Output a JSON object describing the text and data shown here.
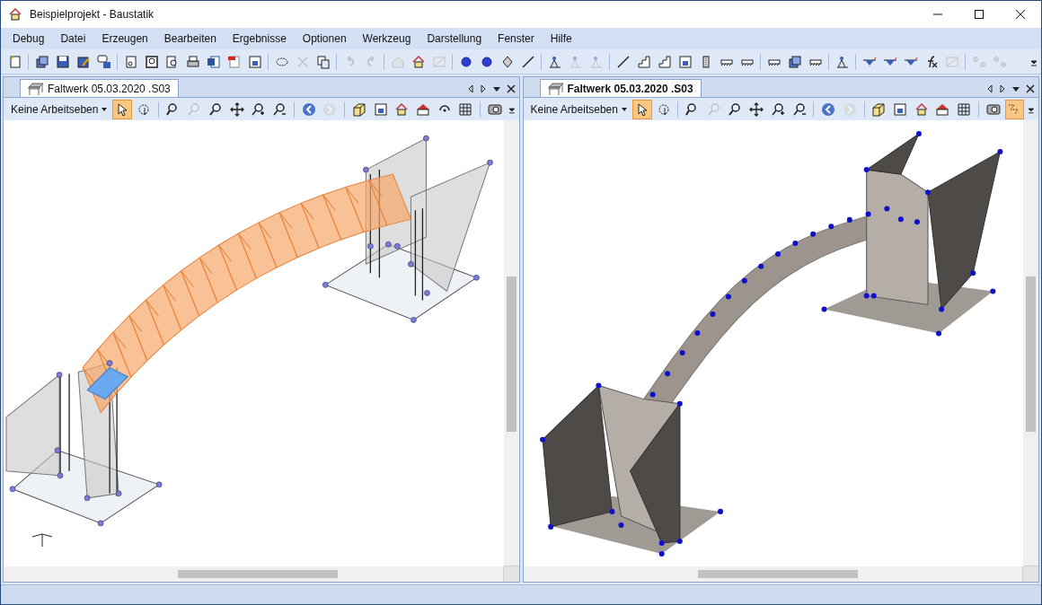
{
  "window": {
    "title": "Beispielprojekt - Baustatik"
  },
  "menu": [
    "Debug",
    "Datei",
    "Erzeugen",
    "Bearbeiten",
    "Ergebnisse",
    "Optionen",
    "Werkzeug",
    "Darstellung",
    "Fenster",
    "Hilfe"
  ],
  "toolbar": [
    [
      {
        "kind": "new",
        "disabled": false
      }
    ],
    [
      {
        "kind": "stack",
        "disabled": false
      },
      {
        "kind": "disk",
        "disabled": false
      },
      {
        "kind": "disk-edit",
        "disabled": false
      },
      {
        "kind": "speech",
        "disabled": false
      }
    ],
    [
      {
        "kind": "page",
        "disabled": false
      },
      {
        "kind": "preview",
        "disabled": false
      },
      {
        "kind": "magnifier",
        "disabled": false
      },
      {
        "kind": "printer",
        "disabled": false
      },
      {
        "kind": "word",
        "disabled": false
      },
      {
        "kind": "pdf",
        "disabled": false
      },
      {
        "kind": "frame",
        "disabled": false
      }
    ],
    [
      {
        "kind": "lasso",
        "disabled": false
      },
      {
        "kind": "cross",
        "disabled": true
      },
      {
        "kind": "copy",
        "disabled": false
      }
    ],
    [
      {
        "kind": "undo",
        "disabled": true
      },
      {
        "kind": "redo",
        "disabled": true
      }
    ],
    [
      {
        "kind": "export",
        "disabled": true
      },
      {
        "kind": "house",
        "disabled": false
      },
      {
        "kind": "window",
        "disabled": true
      }
    ],
    [
      {
        "kind": "sphere",
        "disabled": false
      },
      {
        "kind": "sphere",
        "disabled": false
      },
      {
        "kind": "prism",
        "disabled": false
      },
      {
        "kind": "line",
        "disabled": false
      }
    ],
    [
      {
        "kind": "figure",
        "disabled": false
      },
      {
        "kind": "figure",
        "disabled": true
      },
      {
        "kind": "figure",
        "disabled": true
      }
    ],
    [
      {
        "kind": "line",
        "disabled": false
      },
      {
        "kind": "stair",
        "disabled": false
      },
      {
        "kind": "stair",
        "disabled": false
      },
      {
        "kind": "frame",
        "disabled": false
      },
      {
        "kind": "column",
        "disabled": false
      },
      {
        "kind": "hatch",
        "disabled": false
      },
      {
        "kind": "hatch",
        "disabled": false
      }
    ],
    [
      {
        "kind": "hatch",
        "disabled": false
      },
      {
        "kind": "stack",
        "disabled": false
      },
      {
        "kind": "hatch",
        "disabled": false
      }
    ],
    [
      {
        "kind": "figure",
        "disabled": false
      }
    ],
    [
      {
        "kind": "moment",
        "disabled": false
      },
      {
        "kind": "moment",
        "disabled": false
      },
      {
        "kind": "moment",
        "disabled": false
      },
      {
        "kind": "function",
        "disabled": false
      },
      {
        "kind": "window",
        "disabled": true
      }
    ],
    [
      {
        "kind": "nodes",
        "disabled": true
      },
      {
        "kind": "nodes",
        "disabled": true
      }
    ]
  ],
  "panes": [
    {
      "tab": {
        "label": "Faltwerk 05.03.2020 .S03",
        "selected": false
      },
      "workplane": "Keine Arbeitseben",
      "kind": "wireframe",
      "tools": [
        [
          {
            "kind": "pointer",
            "selected": true,
            "disabled": false
          },
          {
            "kind": "rotate-view",
            "selected": false,
            "disabled": false
          }
        ],
        [
          {
            "kind": "zoom-a",
            "selected": false,
            "disabled": false
          },
          {
            "kind": "zoom",
            "selected": false,
            "disabled": true
          },
          {
            "kind": "zoom",
            "selected": false,
            "disabled": false
          },
          {
            "kind": "move",
            "selected": false,
            "disabled": false
          },
          {
            "kind": "zoom-in",
            "selected": false,
            "disabled": false
          },
          {
            "kind": "zoom-out",
            "selected": false,
            "disabled": false
          }
        ],
        [
          {
            "kind": "back",
            "selected": false,
            "disabled": false
          },
          {
            "kind": "forward",
            "selected": false,
            "disabled": true
          }
        ],
        [
          {
            "kind": "box",
            "selected": false,
            "disabled": false
          },
          {
            "kind": "frame",
            "selected": false,
            "disabled": false
          },
          {
            "kind": "house",
            "selected": false,
            "disabled": false
          },
          {
            "kind": "house-wide",
            "selected": false,
            "disabled": false
          },
          {
            "kind": "rotate",
            "selected": false,
            "disabled": false
          },
          {
            "kind": "grid",
            "selected": false,
            "disabled": false
          }
        ],
        [
          {
            "kind": "camera",
            "selected": false,
            "disabled": false
          }
        ]
      ]
    },
    {
      "tab": {
        "label": "Faltwerk 05.03.2020 .S03",
        "selected": true
      },
      "workplane": "Keine Arbeitseben",
      "kind": "rendered",
      "tools": [
        [
          {
            "kind": "pointer",
            "selected": true,
            "disabled": false
          },
          {
            "kind": "rotate-view",
            "selected": false,
            "disabled": false
          }
        ],
        [
          {
            "kind": "zoom-a",
            "selected": false,
            "disabled": false
          },
          {
            "kind": "zoom",
            "selected": false,
            "disabled": true
          },
          {
            "kind": "zoom",
            "selected": false,
            "disabled": false
          },
          {
            "kind": "move",
            "selected": false,
            "disabled": false
          },
          {
            "kind": "zoom-in",
            "selected": false,
            "disabled": false
          },
          {
            "kind": "zoom-out",
            "selected": false,
            "disabled": false
          }
        ],
        [
          {
            "kind": "back",
            "selected": false,
            "disabled": false
          },
          {
            "kind": "forward",
            "selected": false,
            "disabled": true
          }
        ],
        [
          {
            "kind": "box",
            "selected": false,
            "disabled": false
          },
          {
            "kind": "frame",
            "selected": false,
            "disabled": false
          },
          {
            "kind": "house",
            "selected": false,
            "disabled": false
          },
          {
            "kind": "house-wide",
            "selected": false,
            "disabled": false
          },
          {
            "kind": "grid",
            "selected": false,
            "disabled": false
          }
        ],
        [
          {
            "kind": "camera",
            "selected": false,
            "disabled": false
          },
          {
            "kind": "texture",
            "selected": true,
            "disabled": false
          }
        ]
      ]
    }
  ]
}
